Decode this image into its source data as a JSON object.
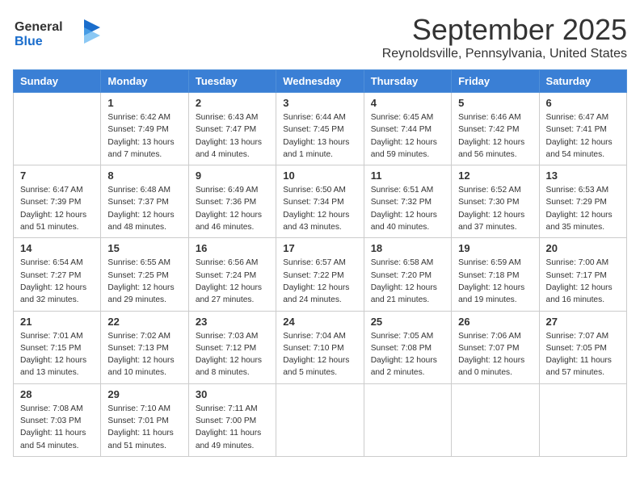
{
  "header": {
    "logo_general": "General",
    "logo_blue": "Blue",
    "month": "September 2025",
    "location": "Reynoldsville, Pennsylvania, United States"
  },
  "weekdays": [
    "Sunday",
    "Monday",
    "Tuesday",
    "Wednesday",
    "Thursday",
    "Friday",
    "Saturday"
  ],
  "weeks": [
    [
      {
        "day": "",
        "sunrise": "",
        "sunset": "",
        "daylight": ""
      },
      {
        "day": "1",
        "sunrise": "Sunrise: 6:42 AM",
        "sunset": "Sunset: 7:49 PM",
        "daylight": "Daylight: 13 hours and 7 minutes."
      },
      {
        "day": "2",
        "sunrise": "Sunrise: 6:43 AM",
        "sunset": "Sunset: 7:47 PM",
        "daylight": "Daylight: 13 hours and 4 minutes."
      },
      {
        "day": "3",
        "sunrise": "Sunrise: 6:44 AM",
        "sunset": "Sunset: 7:45 PM",
        "daylight": "Daylight: 13 hours and 1 minute."
      },
      {
        "day": "4",
        "sunrise": "Sunrise: 6:45 AM",
        "sunset": "Sunset: 7:44 PM",
        "daylight": "Daylight: 12 hours and 59 minutes."
      },
      {
        "day": "5",
        "sunrise": "Sunrise: 6:46 AM",
        "sunset": "Sunset: 7:42 PM",
        "daylight": "Daylight: 12 hours and 56 minutes."
      },
      {
        "day": "6",
        "sunrise": "Sunrise: 6:47 AM",
        "sunset": "Sunset: 7:41 PM",
        "daylight": "Daylight: 12 hours and 54 minutes."
      }
    ],
    [
      {
        "day": "7",
        "sunrise": "Sunrise: 6:47 AM",
        "sunset": "Sunset: 7:39 PM",
        "daylight": "Daylight: 12 hours and 51 minutes."
      },
      {
        "day": "8",
        "sunrise": "Sunrise: 6:48 AM",
        "sunset": "Sunset: 7:37 PM",
        "daylight": "Daylight: 12 hours and 48 minutes."
      },
      {
        "day": "9",
        "sunrise": "Sunrise: 6:49 AM",
        "sunset": "Sunset: 7:36 PM",
        "daylight": "Daylight: 12 hours and 46 minutes."
      },
      {
        "day": "10",
        "sunrise": "Sunrise: 6:50 AM",
        "sunset": "Sunset: 7:34 PM",
        "daylight": "Daylight: 12 hours and 43 minutes."
      },
      {
        "day": "11",
        "sunrise": "Sunrise: 6:51 AM",
        "sunset": "Sunset: 7:32 PM",
        "daylight": "Daylight: 12 hours and 40 minutes."
      },
      {
        "day": "12",
        "sunrise": "Sunrise: 6:52 AM",
        "sunset": "Sunset: 7:30 PM",
        "daylight": "Daylight: 12 hours and 37 minutes."
      },
      {
        "day": "13",
        "sunrise": "Sunrise: 6:53 AM",
        "sunset": "Sunset: 7:29 PM",
        "daylight": "Daylight: 12 hours and 35 minutes."
      }
    ],
    [
      {
        "day": "14",
        "sunrise": "Sunrise: 6:54 AM",
        "sunset": "Sunset: 7:27 PM",
        "daylight": "Daylight: 12 hours and 32 minutes."
      },
      {
        "day": "15",
        "sunrise": "Sunrise: 6:55 AM",
        "sunset": "Sunset: 7:25 PM",
        "daylight": "Daylight: 12 hours and 29 minutes."
      },
      {
        "day": "16",
        "sunrise": "Sunrise: 6:56 AM",
        "sunset": "Sunset: 7:24 PM",
        "daylight": "Daylight: 12 hours and 27 minutes."
      },
      {
        "day": "17",
        "sunrise": "Sunrise: 6:57 AM",
        "sunset": "Sunset: 7:22 PM",
        "daylight": "Daylight: 12 hours and 24 minutes."
      },
      {
        "day": "18",
        "sunrise": "Sunrise: 6:58 AM",
        "sunset": "Sunset: 7:20 PM",
        "daylight": "Daylight: 12 hours and 21 minutes."
      },
      {
        "day": "19",
        "sunrise": "Sunrise: 6:59 AM",
        "sunset": "Sunset: 7:18 PM",
        "daylight": "Daylight: 12 hours and 19 minutes."
      },
      {
        "day": "20",
        "sunrise": "Sunrise: 7:00 AM",
        "sunset": "Sunset: 7:17 PM",
        "daylight": "Daylight: 12 hours and 16 minutes."
      }
    ],
    [
      {
        "day": "21",
        "sunrise": "Sunrise: 7:01 AM",
        "sunset": "Sunset: 7:15 PM",
        "daylight": "Daylight: 12 hours and 13 minutes."
      },
      {
        "day": "22",
        "sunrise": "Sunrise: 7:02 AM",
        "sunset": "Sunset: 7:13 PM",
        "daylight": "Daylight: 12 hours and 10 minutes."
      },
      {
        "day": "23",
        "sunrise": "Sunrise: 7:03 AM",
        "sunset": "Sunset: 7:12 PM",
        "daylight": "Daylight: 12 hours and 8 minutes."
      },
      {
        "day": "24",
        "sunrise": "Sunrise: 7:04 AM",
        "sunset": "Sunset: 7:10 PM",
        "daylight": "Daylight: 12 hours and 5 minutes."
      },
      {
        "day": "25",
        "sunrise": "Sunrise: 7:05 AM",
        "sunset": "Sunset: 7:08 PM",
        "daylight": "Daylight: 12 hours and 2 minutes."
      },
      {
        "day": "26",
        "sunrise": "Sunrise: 7:06 AM",
        "sunset": "Sunset: 7:07 PM",
        "daylight": "Daylight: 12 hours and 0 minutes."
      },
      {
        "day": "27",
        "sunrise": "Sunrise: 7:07 AM",
        "sunset": "Sunset: 7:05 PM",
        "daylight": "Daylight: 11 hours and 57 minutes."
      }
    ],
    [
      {
        "day": "28",
        "sunrise": "Sunrise: 7:08 AM",
        "sunset": "Sunset: 7:03 PM",
        "daylight": "Daylight: 11 hours and 54 minutes."
      },
      {
        "day": "29",
        "sunrise": "Sunrise: 7:10 AM",
        "sunset": "Sunset: 7:01 PM",
        "daylight": "Daylight: 11 hours and 51 minutes."
      },
      {
        "day": "30",
        "sunrise": "Sunrise: 7:11 AM",
        "sunset": "Sunset: 7:00 PM",
        "daylight": "Daylight: 11 hours and 49 minutes."
      },
      {
        "day": "",
        "sunrise": "",
        "sunset": "",
        "daylight": ""
      },
      {
        "day": "",
        "sunrise": "",
        "sunset": "",
        "daylight": ""
      },
      {
        "day": "",
        "sunrise": "",
        "sunset": "",
        "daylight": ""
      },
      {
        "day": "",
        "sunrise": "",
        "sunset": "",
        "daylight": ""
      }
    ]
  ]
}
